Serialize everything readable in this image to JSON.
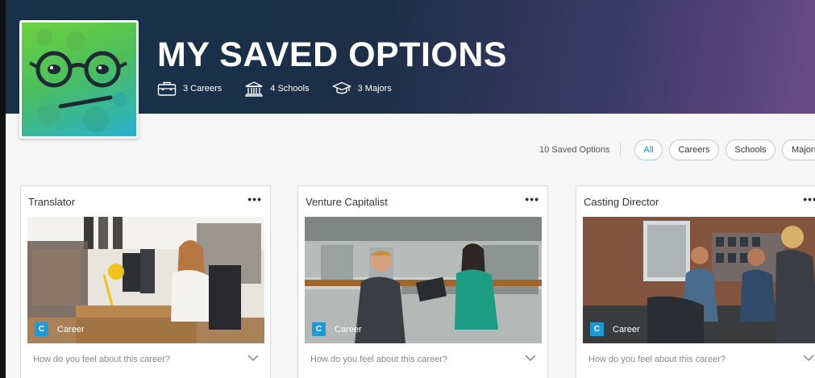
{
  "header": {
    "title": "MY SAVED OPTIONS",
    "stats": [
      {
        "icon": "briefcase-icon",
        "label": "3 Careers"
      },
      {
        "icon": "school-building-icon",
        "label": "4 Schools"
      },
      {
        "icon": "graduation-cap-icon",
        "label": "3 Majors"
      }
    ],
    "avatar_icon": "glasses-face-avatar"
  },
  "filters": {
    "count_label": "10 Saved Options",
    "options": [
      "All",
      "Careers",
      "Schools",
      "Majors"
    ],
    "selected": "All"
  },
  "cards": [
    {
      "title": "Translator",
      "menu": "•••",
      "tag_letter": "C",
      "tag_label": "Career",
      "question": "How do you feel about this career?"
    },
    {
      "title": "Venture Capitalist",
      "menu": "•••",
      "tag_letter": "C",
      "tag_label": "Career",
      "question": "How do you feel about this career?"
    },
    {
      "title": "Casting Director",
      "menu": "•••",
      "tag_letter": "C",
      "tag_label": "Career",
      "question": "How do you feel about this career?"
    }
  ],
  "colors": {
    "accent": "#1e9ad6",
    "hero_start": "#17324a",
    "hero_end": "#6a4b87",
    "avatar_green": "#6ed13e",
    "avatar_blue": "#28b0cf"
  }
}
